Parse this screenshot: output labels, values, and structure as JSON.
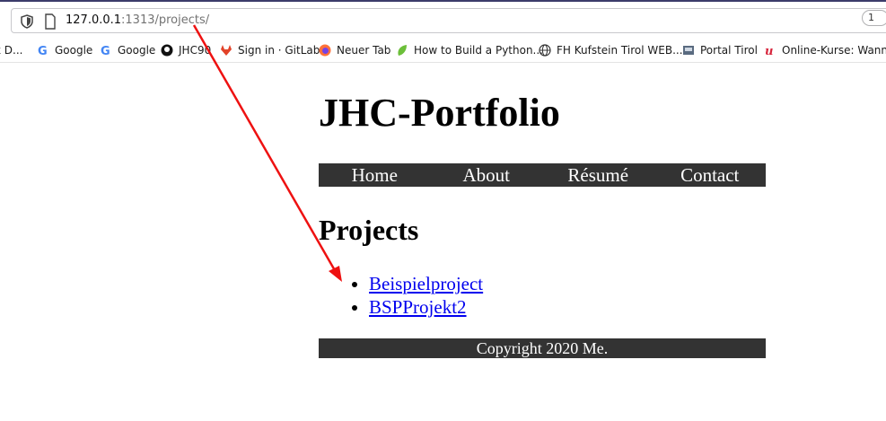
{
  "browser": {
    "url_host": "127.0.0.1",
    "url_rest": ":1313/projects/",
    "right_badge": "1",
    "bookmarks": [
      {
        "label": "k D...",
        "icon": "none"
      },
      {
        "label": "Google",
        "icon": "google-icon"
      },
      {
        "label": "Google",
        "icon": "google-icon"
      },
      {
        "label": "JHC90",
        "icon": "github-icon"
      },
      {
        "label": "Sign in · GitLab",
        "icon": "gitlab-icon"
      },
      {
        "label": "Neuer Tab",
        "icon": "firefox-icon"
      },
      {
        "label": "How to Build a Python...",
        "icon": "leaf-icon"
      },
      {
        "label": "FH Kufstein Tirol WEB...",
        "icon": "globe-icon"
      },
      {
        "label": "Portal Tirol",
        "icon": "portal-icon"
      },
      {
        "label": "Online-Kurse: Wann u",
        "icon": "udemy-icon"
      }
    ]
  },
  "page": {
    "title": "JHC-Portfolio",
    "nav": [
      "Home",
      "About",
      "Résumé",
      "Contact"
    ],
    "section_title": "Projects",
    "projects": [
      "Beispielproject",
      "BSPProjekt2"
    ],
    "footer": "Copyright 2020 Me."
  },
  "colors": {
    "nav_bg": "#333333",
    "link": "#0000ee",
    "annotation_arrow": "#ee1111"
  }
}
